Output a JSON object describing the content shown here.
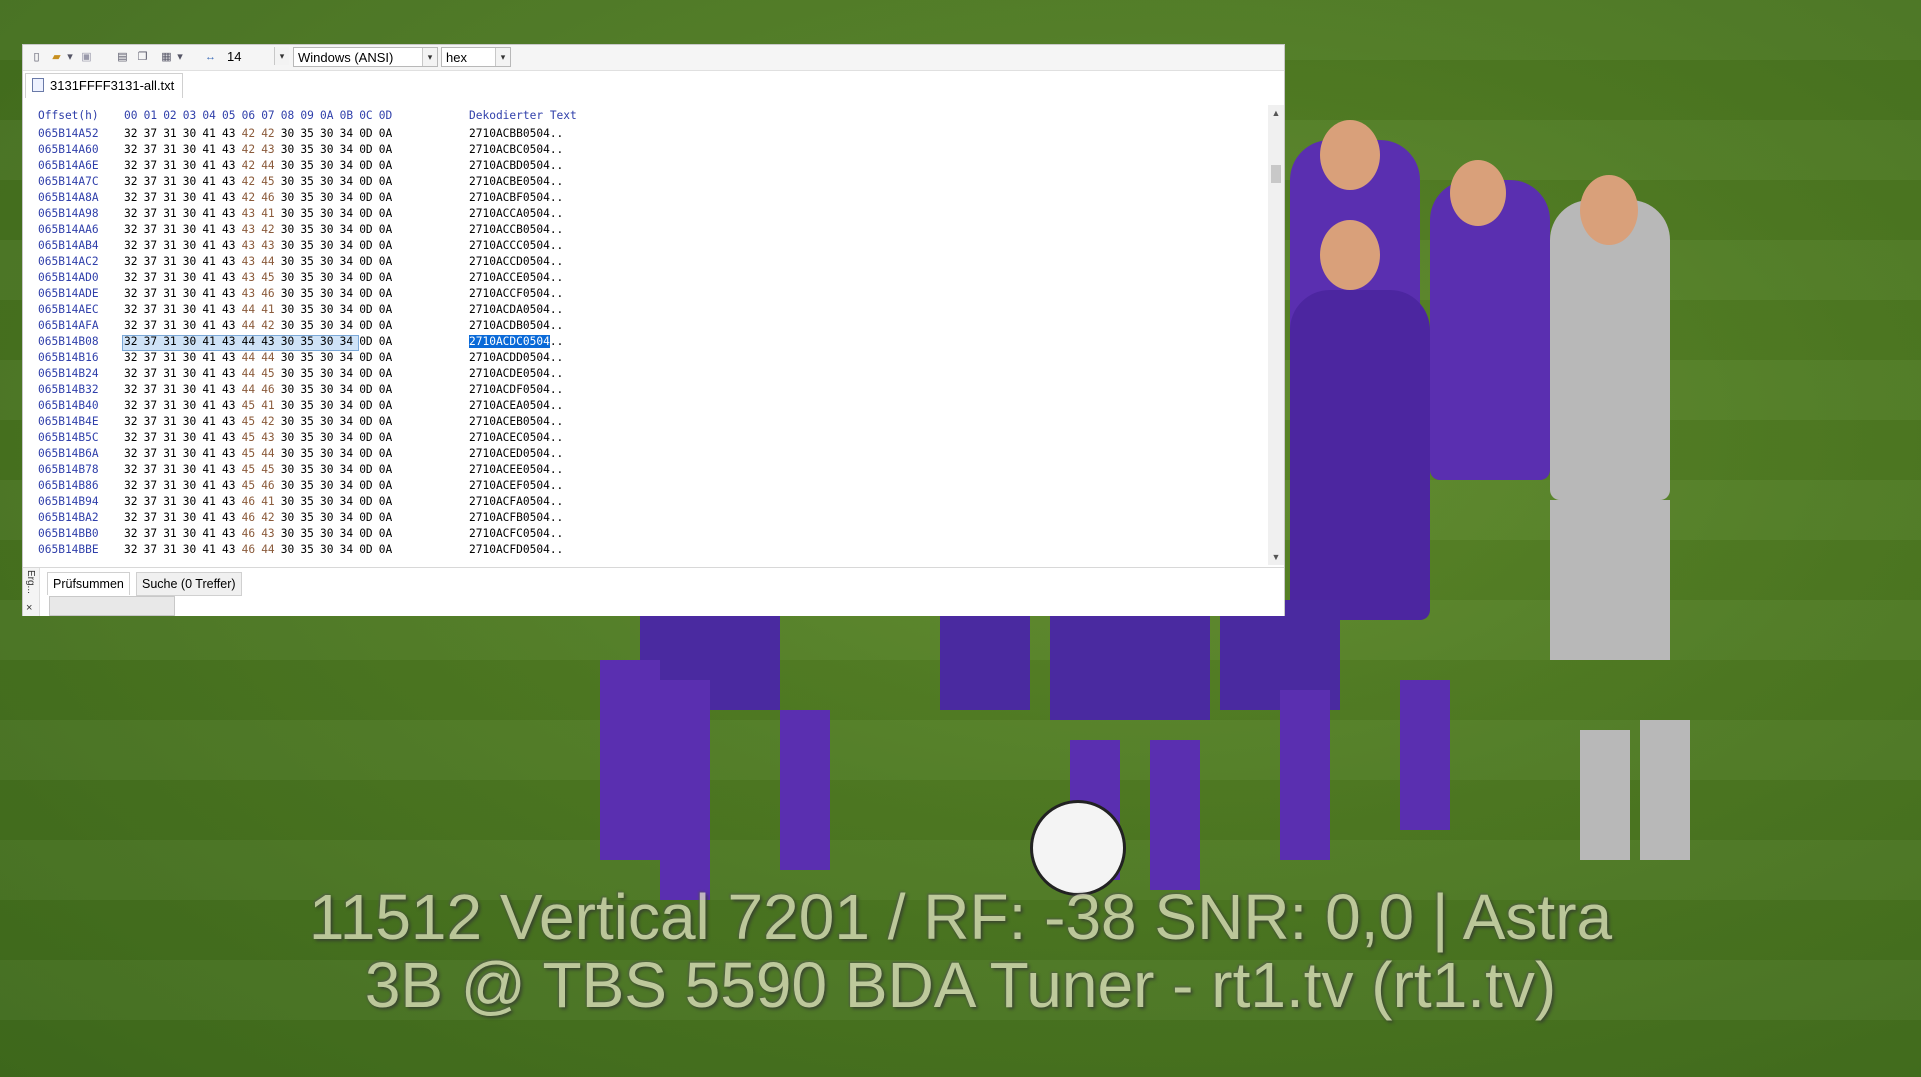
{
  "toolbar": {
    "font_size": "14",
    "encoding": "Windows (ANSI)",
    "view_mode": "hex"
  },
  "file_tab": {
    "label": "3131FFFF3131-all.txt"
  },
  "hex_view": {
    "header_offset": "Offset(h)",
    "header_columns": [
      "00",
      "01",
      "02",
      "03",
      "04",
      "05",
      "06",
      "07",
      "08",
      "09",
      "0A",
      "0B",
      "0C",
      "0D"
    ],
    "header_decoded": "Dekodierter Text",
    "rows": [
      {
        "offset": "065B14A52",
        "bytes": [
          "32",
          "37",
          "31",
          "30",
          "41",
          "43",
          "42",
          "42",
          "30",
          "35",
          "30",
          "34",
          "0D",
          "0A"
        ],
        "text": "2710ACBB0504.."
      },
      {
        "offset": "065B14A60",
        "bytes": [
          "32",
          "37",
          "31",
          "30",
          "41",
          "43",
          "42",
          "43",
          "30",
          "35",
          "30",
          "34",
          "0D",
          "0A"
        ],
        "text": "2710ACBC0504.."
      },
      {
        "offset": "065B14A6E",
        "bytes": [
          "32",
          "37",
          "31",
          "30",
          "41",
          "43",
          "42",
          "44",
          "30",
          "35",
          "30",
          "34",
          "0D",
          "0A"
        ],
        "text": "2710ACBD0504.."
      },
      {
        "offset": "065B14A7C",
        "bytes": [
          "32",
          "37",
          "31",
          "30",
          "41",
          "43",
          "42",
          "45",
          "30",
          "35",
          "30",
          "34",
          "0D",
          "0A"
        ],
        "text": "2710ACBE0504.."
      },
      {
        "offset": "065B14A8A",
        "bytes": [
          "32",
          "37",
          "31",
          "30",
          "41",
          "43",
          "42",
          "46",
          "30",
          "35",
          "30",
          "34",
          "0D",
          "0A"
        ],
        "text": "2710ACBF0504.."
      },
      {
        "offset": "065B14A98",
        "bytes": [
          "32",
          "37",
          "31",
          "30",
          "41",
          "43",
          "43",
          "41",
          "30",
          "35",
          "30",
          "34",
          "0D",
          "0A"
        ],
        "text": "2710ACCA0504.."
      },
      {
        "offset": "065B14AA6",
        "bytes": [
          "32",
          "37",
          "31",
          "30",
          "41",
          "43",
          "43",
          "42",
          "30",
          "35",
          "30",
          "34",
          "0D",
          "0A"
        ],
        "text": "2710ACCB0504.."
      },
      {
        "offset": "065B14AB4",
        "bytes": [
          "32",
          "37",
          "31",
          "30",
          "41",
          "43",
          "43",
          "43",
          "30",
          "35",
          "30",
          "34",
          "0D",
          "0A"
        ],
        "text": "2710ACCC0504.."
      },
      {
        "offset": "065B14AC2",
        "bytes": [
          "32",
          "37",
          "31",
          "30",
          "41",
          "43",
          "43",
          "44",
          "30",
          "35",
          "30",
          "34",
          "0D",
          "0A"
        ],
        "text": "2710ACCD0504.."
      },
      {
        "offset": "065B14AD0",
        "bytes": [
          "32",
          "37",
          "31",
          "30",
          "41",
          "43",
          "43",
          "45",
          "30",
          "35",
          "30",
          "34",
          "0D",
          "0A"
        ],
        "text": "2710ACCE0504.."
      },
      {
        "offset": "065B14ADE",
        "bytes": [
          "32",
          "37",
          "31",
          "30",
          "41",
          "43",
          "43",
          "46",
          "30",
          "35",
          "30",
          "34",
          "0D",
          "0A"
        ],
        "text": "2710ACCF0504.."
      },
      {
        "offset": "065B14AEC",
        "bytes": [
          "32",
          "37",
          "31",
          "30",
          "41",
          "43",
          "44",
          "41",
          "30",
          "35",
          "30",
          "34",
          "0D",
          "0A"
        ],
        "text": "2710ACDA0504.."
      },
      {
        "offset": "065B14AFA",
        "bytes": [
          "32",
          "37",
          "31",
          "30",
          "41",
          "43",
          "44",
          "42",
          "30",
          "35",
          "30",
          "34",
          "0D",
          "0A"
        ],
        "text": "2710ACDB0504.."
      },
      {
        "offset": "065B14B08",
        "bytes": [
          "32",
          "37",
          "31",
          "30",
          "41",
          "43",
          "44",
          "43",
          "30",
          "35",
          "30",
          "34",
          "0D",
          "0A"
        ],
        "text": "2710ACDC0504..",
        "selected": true
      },
      {
        "offset": "065B14B16",
        "bytes": [
          "32",
          "37",
          "31",
          "30",
          "41",
          "43",
          "44",
          "44",
          "30",
          "35",
          "30",
          "34",
          "0D",
          "0A"
        ],
        "text": "2710ACDD0504.."
      },
      {
        "offset": "065B14B24",
        "bytes": [
          "32",
          "37",
          "31",
          "30",
          "41",
          "43",
          "44",
          "45",
          "30",
          "35",
          "30",
          "34",
          "0D",
          "0A"
        ],
        "text": "2710ACDE0504.."
      },
      {
        "offset": "065B14B32",
        "bytes": [
          "32",
          "37",
          "31",
          "30",
          "41",
          "43",
          "44",
          "46",
          "30",
          "35",
          "30",
          "34",
          "0D",
          "0A"
        ],
        "text": "2710ACDF0504.."
      },
      {
        "offset": "065B14B40",
        "bytes": [
          "32",
          "37",
          "31",
          "30",
          "41",
          "43",
          "45",
          "41",
          "30",
          "35",
          "30",
          "34",
          "0D",
          "0A"
        ],
        "text": "2710ACEA0504.."
      },
      {
        "offset": "065B14B4E",
        "bytes": [
          "32",
          "37",
          "31",
          "30",
          "41",
          "43",
          "45",
          "42",
          "30",
          "35",
          "30",
          "34",
          "0D",
          "0A"
        ],
        "text": "2710ACEB0504.."
      },
      {
        "offset": "065B14B5C",
        "bytes": [
          "32",
          "37",
          "31",
          "30",
          "41",
          "43",
          "45",
          "43",
          "30",
          "35",
          "30",
          "34",
          "0D",
          "0A"
        ],
        "text": "2710ACEC0504.."
      },
      {
        "offset": "065B14B6A",
        "bytes": [
          "32",
          "37",
          "31",
          "30",
          "41",
          "43",
          "45",
          "44",
          "30",
          "35",
          "30",
          "34",
          "0D",
          "0A"
        ],
        "text": "2710ACED0504.."
      },
      {
        "offset": "065B14B78",
        "bytes": [
          "32",
          "37",
          "31",
          "30",
          "41",
          "43",
          "45",
          "45",
          "30",
          "35",
          "30",
          "34",
          "0D",
          "0A"
        ],
        "text": "2710ACEE0504.."
      },
      {
        "offset": "065B14B86",
        "bytes": [
          "32",
          "37",
          "31",
          "30",
          "41",
          "43",
          "45",
          "46",
          "30",
          "35",
          "30",
          "34",
          "0D",
          "0A"
        ],
        "text": "2710ACEF0504.."
      },
      {
        "offset": "065B14B94",
        "bytes": [
          "32",
          "37",
          "31",
          "30",
          "41",
          "43",
          "46",
          "41",
          "30",
          "35",
          "30",
          "34",
          "0D",
          "0A"
        ],
        "text": "2710ACFA0504.."
      },
      {
        "offset": "065B14BA2",
        "bytes": [
          "32",
          "37",
          "31",
          "30",
          "41",
          "43",
          "46",
          "42",
          "30",
          "35",
          "30",
          "34",
          "0D",
          "0A"
        ],
        "text": "2710ACFB0504.."
      },
      {
        "offset": "065B14BB0",
        "bytes": [
          "32",
          "37",
          "31",
          "30",
          "41",
          "43",
          "46",
          "43",
          "30",
          "35",
          "30",
          "34",
          "0D",
          "0A"
        ],
        "text": "2710ACFC0504.."
      },
      {
        "offset": "065B14BBE",
        "bytes": [
          "32",
          "37",
          "31",
          "30",
          "41",
          "43",
          "46",
          "44",
          "30",
          "35",
          "30",
          "34",
          "0D",
          "0A"
        ],
        "text": "2710ACFD0504.."
      }
    ]
  },
  "bottom_panel": {
    "side_label": "Erg...",
    "close": "×",
    "tabs": [
      "Prüfsummen",
      "Suche (0 Treffer)"
    ]
  },
  "overlay": {
    "line1": "11512 Vertical 7201 / RF: -38 SNR: 0,0 | Astra",
    "line2": "3B @ TBS 5590 BDA Tuner - rt1.tv (rt1.tv)"
  },
  "colors": {
    "offset_blue": "#2f3faa",
    "selection_text_bg": "#0a6ad8",
    "selection_bytes_bg": "#cfe3f7",
    "team_purple": "#5a2fb0",
    "pitch_green": "#4e7a22"
  }
}
